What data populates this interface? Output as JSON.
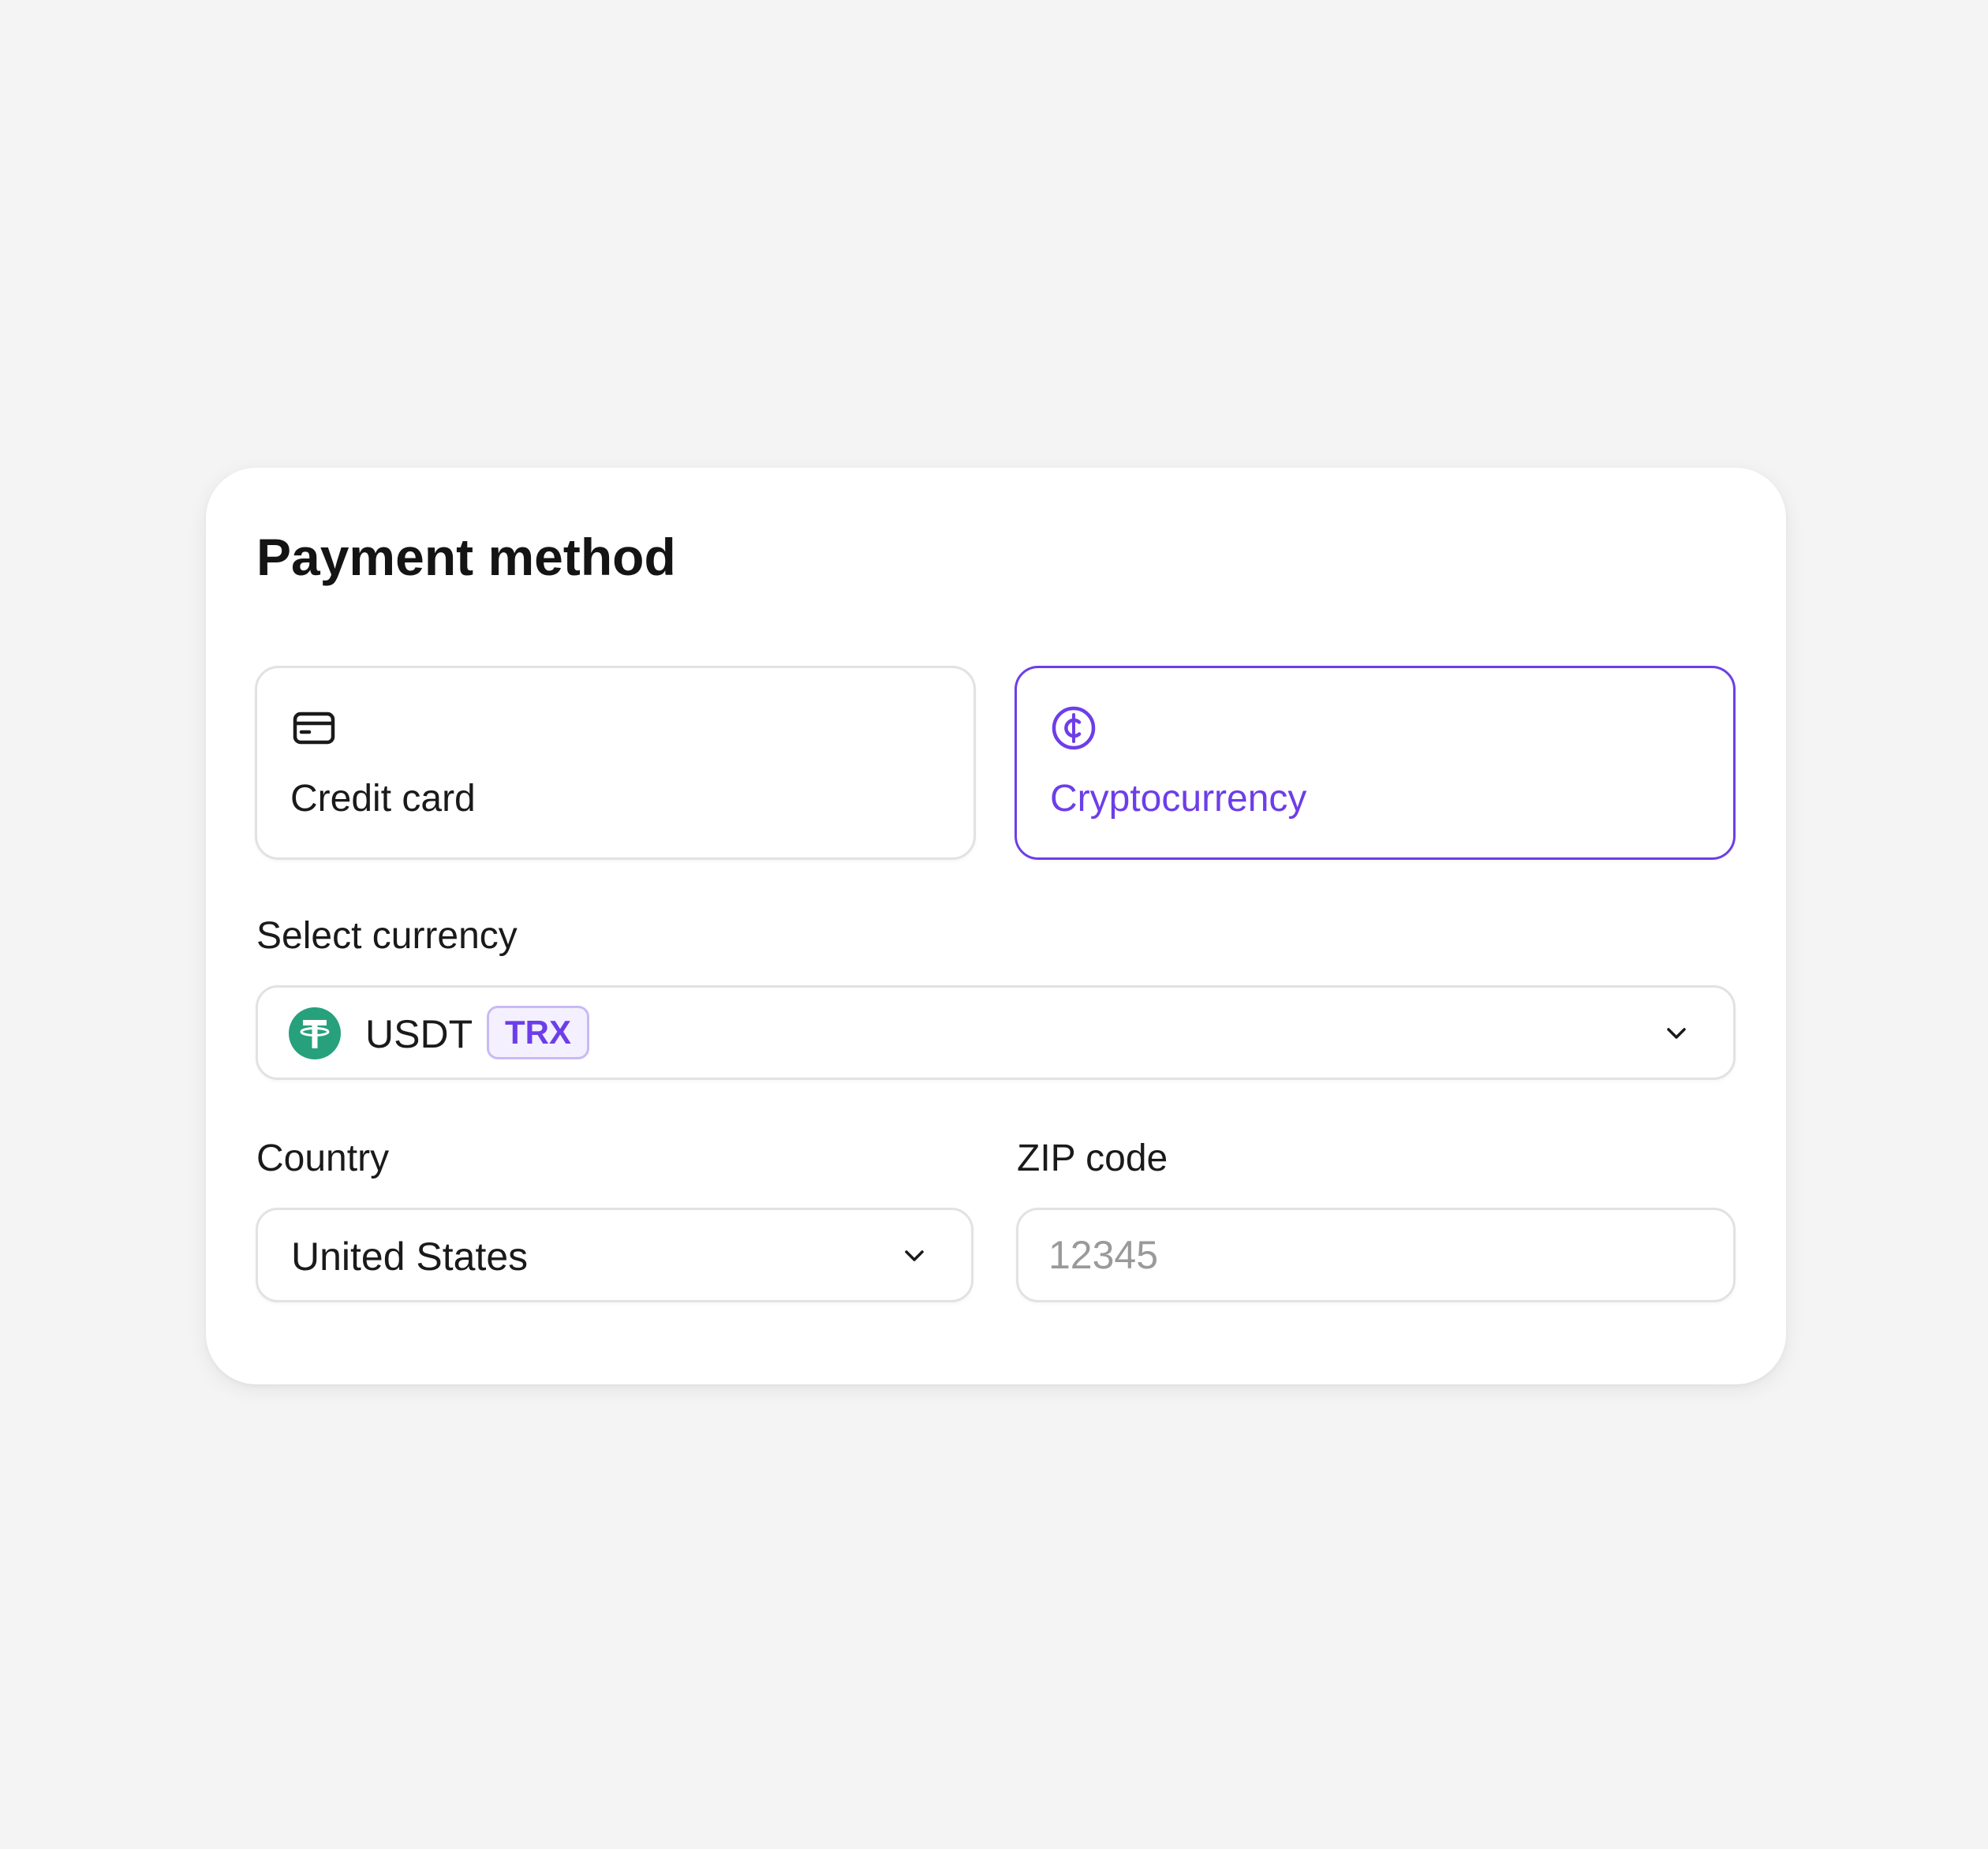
{
  "page": {
    "title": "Payment method"
  },
  "payment_options": [
    {
      "label": "Credit card",
      "icon": "credit-card-icon",
      "selected": false
    },
    {
      "label": "Cryptocurrency",
      "icon": "cent-coin-icon",
      "selected": true
    }
  ],
  "currency": {
    "label": "Select currency",
    "value": "USDT",
    "network": "TRX",
    "icon": "tether-logo-icon"
  },
  "country": {
    "label": "Country",
    "value": "United States"
  },
  "zip": {
    "label": "ZIP code",
    "value": "",
    "placeholder": "12345"
  },
  "colors": {
    "accent": "#6d3ee8",
    "tether": "#26a17b",
    "background": "#f4f4f4",
    "card": "#ffffff",
    "border": "#e2e2e2"
  }
}
